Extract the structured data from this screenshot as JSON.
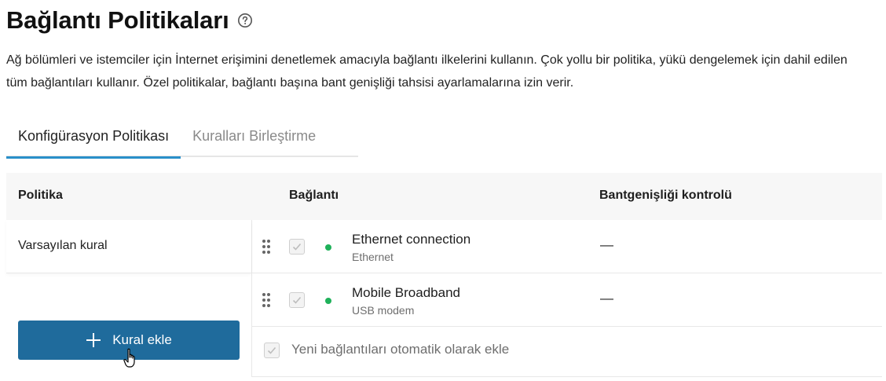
{
  "page": {
    "title": "Bağlantı Politikaları",
    "description": "Ağ bölümleri ve istemciler için İnternet erişimini denetlemek amacıyla bağlantı ilkelerini kullanın. Çok yollu bir politika, yükü dengelemek için dahil edilen tüm bağlantıları kullanır. Özel politikalar, bağlantı başına bant genişliği tahsisi ayarlamalarına izin verir."
  },
  "tabs": [
    {
      "label": "Konfigürasyon Politikası",
      "active": true
    },
    {
      "label": "Kuralları Birleştirme",
      "active": false
    }
  ],
  "table": {
    "headers": {
      "policy": "Politika",
      "connection": "Bağlantı",
      "bandwidth": "Bantgenişliği kontrolü"
    },
    "policies": [
      {
        "name": "Varsayılan kural"
      }
    ],
    "connections": [
      {
        "name": "Ethernet connection",
        "type": "Ethernet",
        "bandwidth": "—",
        "checked": true,
        "status": "online"
      },
      {
        "name": "Mobile Broadband",
        "type": "USB modem",
        "bandwidth": "—",
        "checked": true,
        "status": "online"
      }
    ],
    "auto_add_label": "Yeni bağlantıları otomatik olarak ekle",
    "add_rule_label": "Kural ekle"
  },
  "colors": {
    "accent": "#2a8fc9",
    "button": "#1f6b9c",
    "status_online": "#1fb15a"
  }
}
